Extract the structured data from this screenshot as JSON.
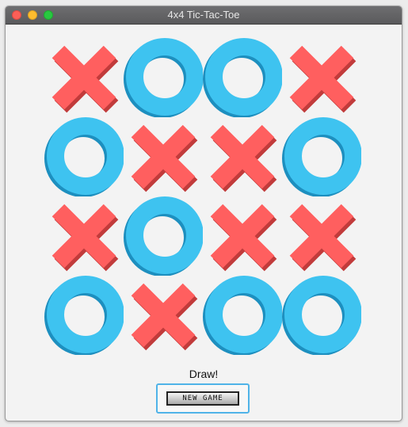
{
  "window": {
    "title": "4x4 Tic-Tac-Toe"
  },
  "board": {
    "rows": 4,
    "cols": 4,
    "cells": [
      "X",
      "O",
      "O",
      "X",
      "O",
      "X",
      "X",
      "O",
      "X",
      "O",
      "X",
      "X",
      "O",
      "X",
      "O",
      "O"
    ]
  },
  "status": {
    "text": "Draw!"
  },
  "controls": {
    "new_game_label": "NEW GAME"
  },
  "colors": {
    "x_color": "#ff5f5f",
    "x_shadow": "#c13b3b",
    "o_color": "#3ec3f0",
    "o_shadow": "#1d8fbf"
  }
}
